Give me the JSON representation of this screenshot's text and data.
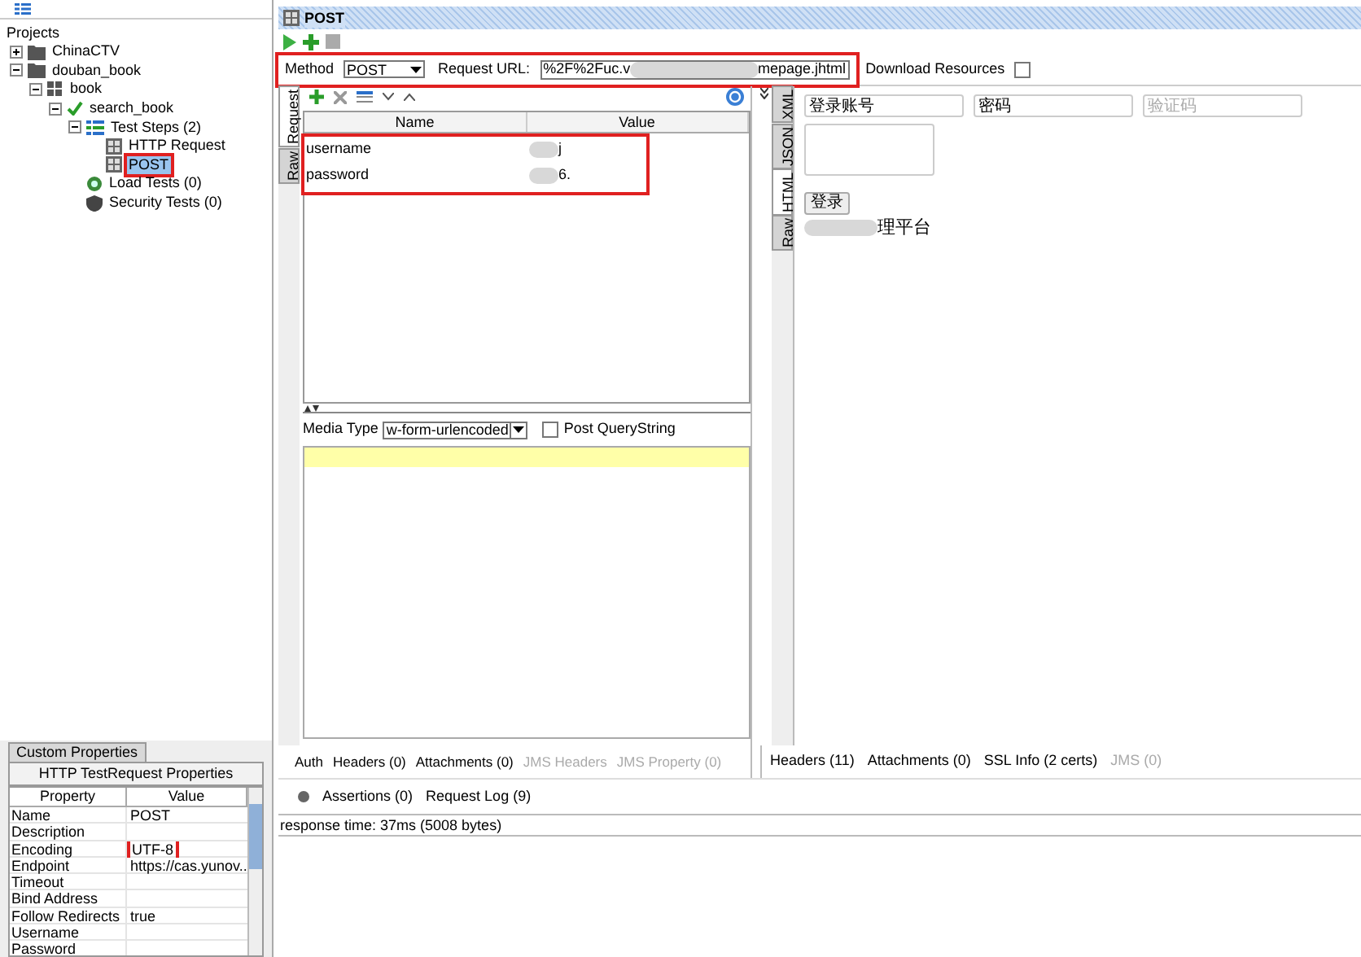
{
  "sidebar": {
    "heading": "Projects",
    "tree": [
      {
        "label": "ChinaCTV",
        "kind": "folder",
        "expanded": false,
        "selected": false
      },
      {
        "label": "douban_book",
        "kind": "folder",
        "expanded": true,
        "selected": false,
        "children": [
          {
            "label": "book",
            "kind": "suite",
            "expanded": true,
            "selected": false,
            "children": [
              {
                "label": "search_book",
                "kind": "case",
                "expanded": true,
                "selected": false,
                "children": [
                  {
                    "label": "Test Steps (2)",
                    "kind": "steps",
                    "expanded": true,
                    "selected": false,
                    "children": [
                      {
                        "label": "HTTP Request",
                        "kind": "request",
                        "selected": false
                      },
                      {
                        "label": "POST",
                        "kind": "request",
                        "selected": true,
                        "highlighted": true
                      }
                    ]
                  },
                  {
                    "label": "Load Tests (0)",
                    "kind": "load",
                    "selected": false
                  },
                  {
                    "label": "Security Tests (0)",
                    "kind": "security",
                    "selected": false
                  }
                ]
              }
            ]
          }
        ]
      }
    ]
  },
  "properties": {
    "tab": "Custom Properties",
    "title": "HTTP TestRequest Properties",
    "columns": [
      "Property",
      "Value"
    ],
    "rows": [
      {
        "name": "Name",
        "value": "POST"
      },
      {
        "name": "Description",
        "value": ""
      },
      {
        "name": "Encoding",
        "value": "UTF-8",
        "highlighted": true
      },
      {
        "name": "Endpoint",
        "value": "https://cas.yunov..."
      },
      {
        "name": "Timeout",
        "value": ""
      },
      {
        "name": "Bind Address",
        "value": ""
      },
      {
        "name": "Follow Redirects",
        "value": "true"
      },
      {
        "name": "Username",
        "value": ""
      },
      {
        "name": "Password",
        "value": ""
      }
    ]
  },
  "editor": {
    "title": "POST",
    "method_label": "Method",
    "method": "POST",
    "url_label": "Request URL:",
    "url_start": "%2F%2Fuc.v",
    "url_end": "mepage.jhtml",
    "url_highlighted": true,
    "download_label": "Download Resources",
    "download_checked": false,
    "request_tabs": [
      {
        "label": "Request",
        "selected": true
      },
      {
        "label": "Raw",
        "selected": false
      }
    ],
    "params": {
      "columns": [
        "Name",
        "Value"
      ],
      "highlighted": true,
      "rows": [
        {
          "name": "username",
          "value": "j"
        },
        {
          "name": "password",
          "value": "6."
        }
      ]
    },
    "media_type_label": "Media Type",
    "media_type": "w-form-urlencoded",
    "post_querystring_label": "Post QueryString",
    "post_querystring_checked": false,
    "request_bottom_tabs": [
      {
        "label": "Auth",
        "disabled": false
      },
      {
        "label": "Headers (0)",
        "disabled": false
      },
      {
        "label": "Attachments (0)",
        "disabled": false
      },
      {
        "label": "JMS Headers",
        "disabled": true
      },
      {
        "label": "JMS Property (0)",
        "disabled": true
      }
    ],
    "response_tabs": [
      {
        "label": "XML",
        "selected": false
      },
      {
        "label": "JSON",
        "selected": false
      },
      {
        "label": "HTML",
        "selected": true
      },
      {
        "label": "Raw",
        "selected": false
      }
    ],
    "html_preview": {
      "fields": [
        {
          "value": "登录账号"
        },
        {
          "value": "密码"
        },
        {
          "placeholder": "验证码"
        }
      ],
      "button": "登录",
      "caption": "理平台"
    },
    "response_bottom_tabs": [
      {
        "label": "Headers (11)",
        "disabled": false
      },
      {
        "label": "Attachments (0)",
        "disabled": false
      },
      {
        "label": "SSL Info (2 certs)",
        "disabled": false
      },
      {
        "label": "JMS (0)",
        "disabled": true
      }
    ],
    "log_tabs": [
      "Assertions (0)",
      "Request Log (9)"
    ],
    "status": "response time: 37ms (5008 bytes)"
  }
}
